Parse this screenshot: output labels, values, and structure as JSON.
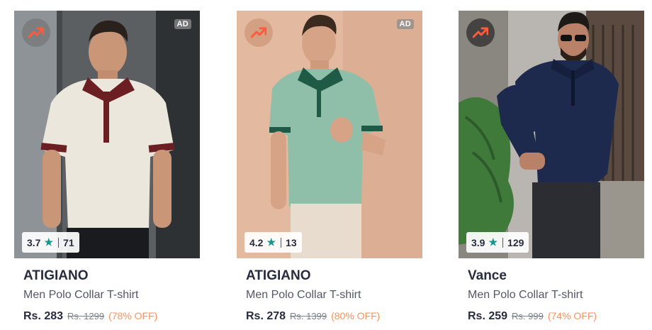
{
  "products": [
    {
      "brand": "ATIGIANO",
      "name": "Men Polo Collar T-shirt",
      "rating": "3.7",
      "rating_count": "71",
      "price": "Rs. 283",
      "mrp": "Rs. 1299",
      "discount": "(78% OFF)",
      "ad_label": "AD",
      "image": "man-in-cream-polo-with-maroon-collar"
    },
    {
      "brand": "ATIGIANO",
      "name": "Men Polo Collar T-shirt",
      "rating": "4.2",
      "rating_count": "13",
      "price": "Rs. 278",
      "mrp": "Rs. 1399",
      "discount": "(80% OFF)",
      "ad_label": "AD",
      "image": "man-in-mint-green-polo-with-dark-green-collar"
    },
    {
      "brand": "Vance",
      "name": "Men Polo Collar T-shirt",
      "rating": "3.9",
      "rating_count": "129",
      "price": "Rs. 259",
      "mrp": "Rs. 999",
      "discount": "(74% OFF)",
      "image": "man-in-navy-long-sleeve-polo"
    }
  ],
  "icons": {
    "trending": "trending-up-icon",
    "star": "star-icon"
  },
  "colors": {
    "trend": "#ff5a3c",
    "star": "#14958f",
    "discount": "#ff905a"
  }
}
